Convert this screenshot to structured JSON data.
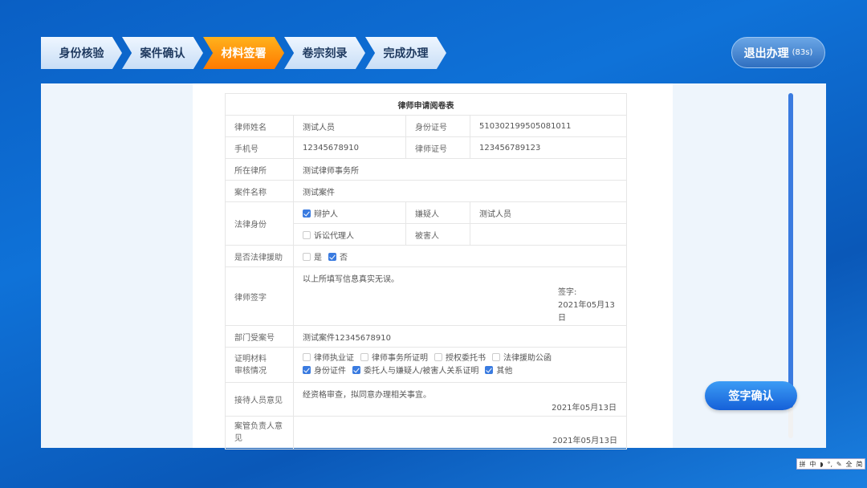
{
  "steps": [
    "身份核验",
    "案件确认",
    "材料签署",
    "卷宗刻录",
    "完成办理"
  ],
  "active_step": 2,
  "exit": {
    "label": "退出办理",
    "countdown": "(83s)"
  },
  "form": {
    "title": "律师申请阅卷表",
    "name_label": "律师姓名",
    "name": "测试人员",
    "id_label": "身份证号",
    "id": "510302199505081011",
    "phone_label": "手机号",
    "phone": "12345678910",
    "license_label": "律师证号",
    "license": "123456789123",
    "firm_label": "所在律所",
    "firm": "测试律师事务所",
    "case_label": "案件名称",
    "case": "测试案件",
    "role_label": "法律身份",
    "role_defender": "辩护人",
    "role_agent": "诉讼代理人",
    "suspect_label": "嫌疑人",
    "suspect": "测试人员",
    "victim_label": "被害人",
    "aid_label": "是否法律援助",
    "aid_yes": "是",
    "aid_no": "否",
    "sign_label": "律师签字",
    "sign_text": "以上所填写信息真实无误。",
    "sign_prefix": "签字:",
    "sign_date": "2021年05月13日",
    "dept_label": "部门受案号",
    "dept": "测试案件12345678910",
    "material_label_1": "证明材料",
    "material_label_2": "审核情况",
    "materials": [
      {
        "label": "律师执业证",
        "checked": false
      },
      {
        "label": "律师事务所证明",
        "checked": false
      },
      {
        "label": "授权委托书",
        "checked": false
      },
      {
        "label": "法律援助公函",
        "checked": false
      },
      {
        "label": "身份证件",
        "checked": true
      },
      {
        "label": "委托人与嫌疑人/被害人关系证明",
        "checked": true
      },
      {
        "label": "其他",
        "checked": true
      }
    ],
    "reception_label": "接待人员意见",
    "reception": "经资格审查，拟同意办理相关事宜。",
    "reception_date": "2021年05月13日",
    "manager_label": "案管负责人意见",
    "manager_date": "2021年05月13日"
  },
  "sign_button": "签字确认",
  "ime": [
    "拼",
    "中",
    "◗",
    "°,",
    "✎",
    "全",
    "简"
  ]
}
